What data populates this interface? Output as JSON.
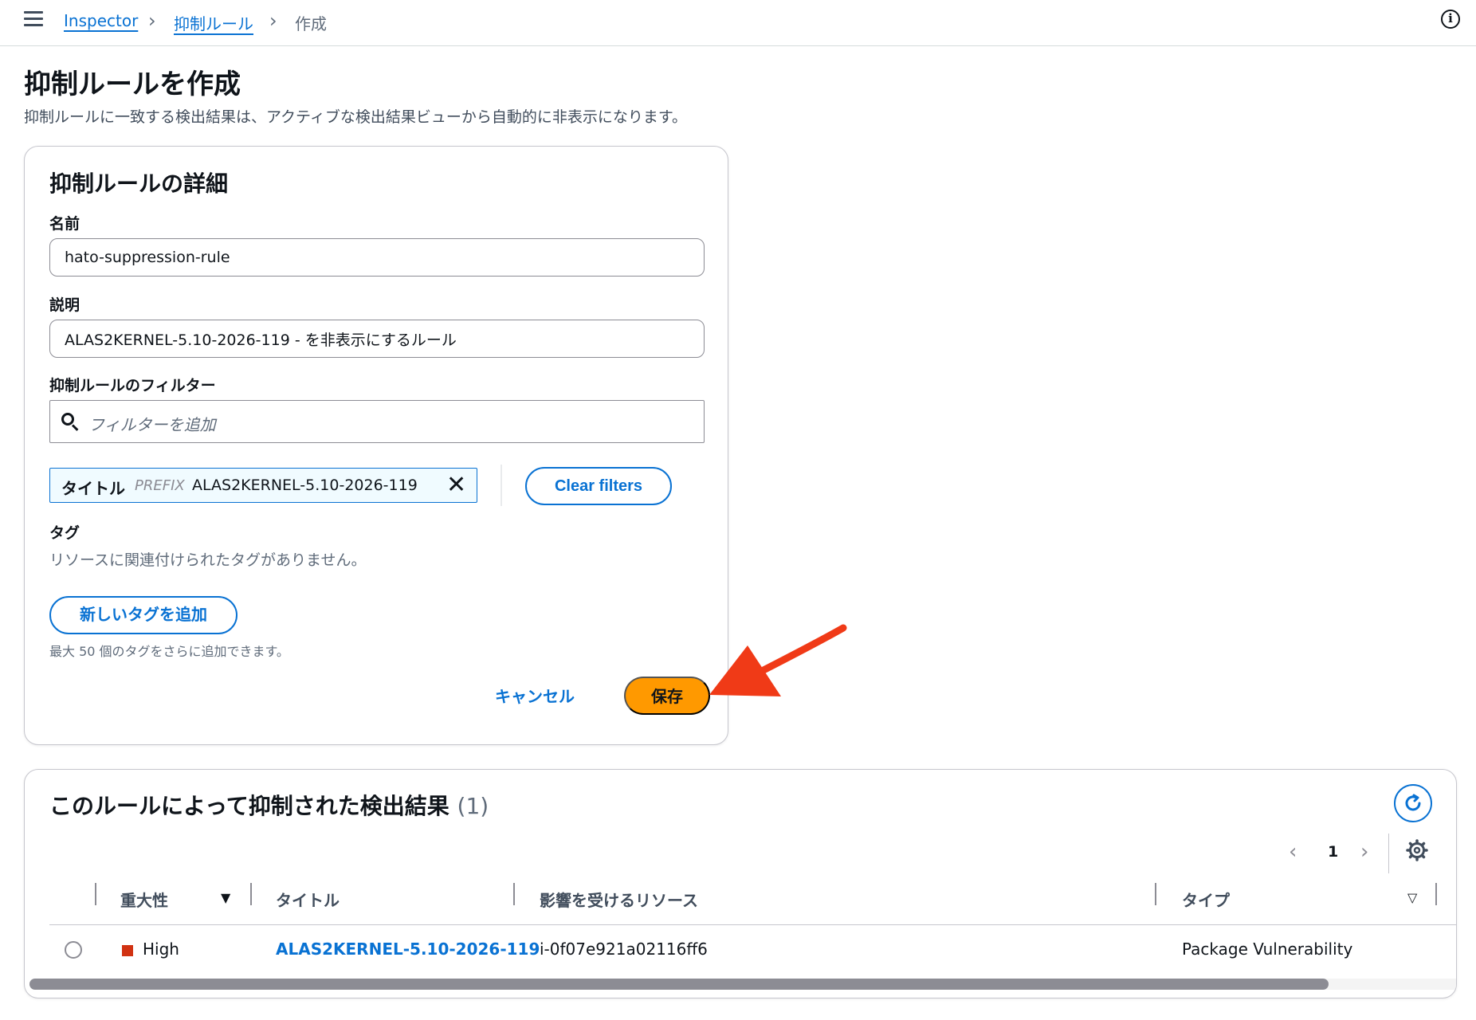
{
  "breadcrumb": {
    "items": [
      "Inspector",
      "抑制ルール"
    ],
    "current": "作成"
  },
  "page": {
    "title": "抑制ルールを作成",
    "description": "抑制ルールに一致する検出結果は、アクティブな検出結果ビューから自動的に非表示になります。"
  },
  "details": {
    "title": "抑制ルールの詳細",
    "name_label": "名前",
    "name_value": "hato-suppression-rule",
    "description_label": "説明",
    "description_value": "ALAS2KERNEL-5.10-2026-119 - を非表示にするルール",
    "filter_label": "抑制ルールのフィルター",
    "filter_placeholder": "フィルターを追加",
    "filter_token": {
      "key": "タイトル",
      "operator": "PREFIX",
      "value": "ALAS2KERNEL-5.10-2026-119"
    },
    "clear_filters_label": "Clear filters",
    "tags_label": "タグ",
    "tags_empty": "リソースに関連付けられたタグがありません。",
    "add_tag_label": "新しいタグを追加",
    "tags_hint": "最大 50 個のタグをさらに追加できます。",
    "cancel_label": "キャンセル",
    "save_label": "保存"
  },
  "findings": {
    "title": "このルールによって抑制された検出結果",
    "count": "(1)",
    "pagination": {
      "current_page": "1"
    },
    "columns": [
      "重大性",
      "タイトル",
      "影響を受けるリソース",
      "タイプ"
    ],
    "rows": [
      {
        "severity": "High",
        "title": "ALAS2KERNEL-5.10-2026-119",
        "resource": "i-0f07e921a02116ff6",
        "type": "Package Vulnerability"
      }
    ]
  },
  "colors": {
    "link": "#0972d3",
    "primary_button": "#ff9900",
    "severity_high": "#d13212",
    "annotation_arrow": "#f03a17"
  },
  "icons": [
    "menu-icon",
    "info-icon",
    "search-icon",
    "close-icon",
    "refresh-icon",
    "chevron-left-icon",
    "chevron-right-icon",
    "gear-icon",
    "sort-down-icon"
  ]
}
